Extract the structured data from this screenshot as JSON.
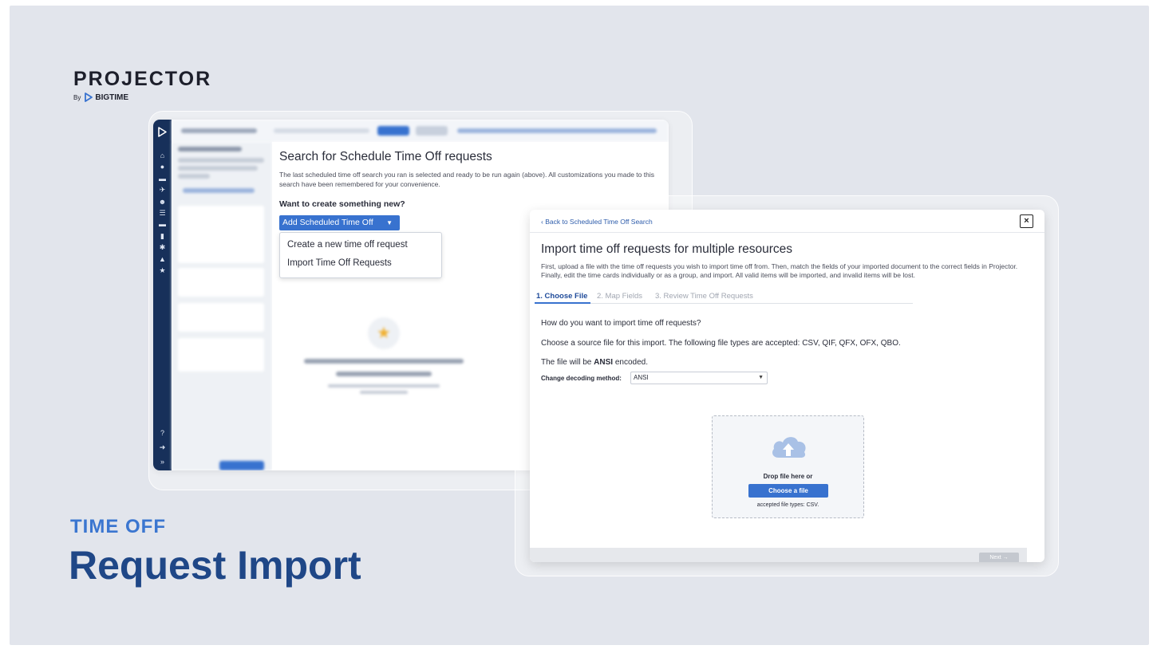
{
  "brand": {
    "name": "PROJECTOR",
    "by": "By",
    "company": "BIGTIME"
  },
  "hero": {
    "kicker": "TIME OFF",
    "title": "Request Import"
  },
  "search_panel": {
    "title": "Search for Schedule Time Off requests",
    "description": "The last scheduled time off search you ran is selected and ready to be run again (above). All customizations you made to this search have been remembered for your convenience.",
    "want_new": "Want to create something new?",
    "add_button": "Add Scheduled Time Off",
    "dropdown": [
      "Create a new time off request",
      "Import Time Off Requests"
    ]
  },
  "import_panel": {
    "back_link": "Back to Scheduled Time Off Search",
    "close": "×",
    "title": "Import time off requests for multiple resources",
    "description": "First, upload a file with the time off requests you wish to import time off from. Then, match the fields of your imported document to the correct fields in Projector. Finally, edit the time cards individually or as a group, and import. All valid items will be imported, and invalid items will be lost.",
    "tabs": [
      "1. Choose File",
      "2. Map Fields",
      "3. Review Time Off Requests"
    ],
    "question": "How do you want to import time off requests?",
    "source_text": "Choose a source file for this import. The following file types are accepted: CSV, QIF, QFX, OFX, QBO.",
    "encoded_prefix": "The file will be",
    "encoded_value": "ANSI",
    "encoded_suffix": "encoded.",
    "decode_label": "Change decoding method:",
    "decode_value": "ANSI",
    "drop_text": "Drop file here or",
    "choose_button": "Choose a file",
    "accepted": "accepted file types: CSV.",
    "next_button": "Next →"
  },
  "colors": {
    "accent": "#3872cf",
    "nav": "#17305a",
    "headline": "#1f4787",
    "background": "#e2e5ec"
  }
}
